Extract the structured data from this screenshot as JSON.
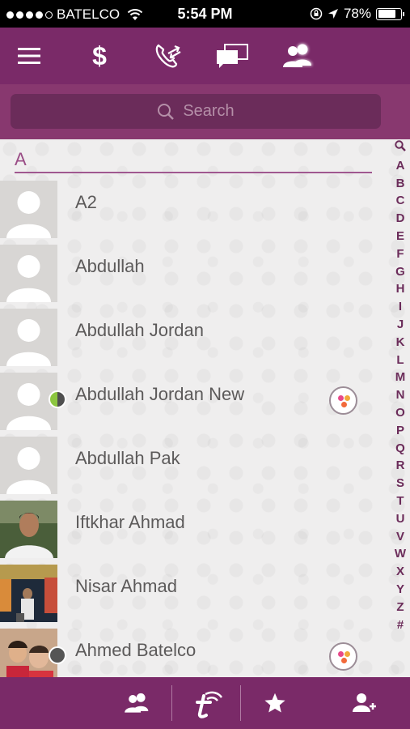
{
  "status_bar": {
    "carrier": "BATELCO",
    "time": "5:54 PM",
    "battery_percent": "78%",
    "battery_level": 0.78,
    "signal_bars": 4,
    "icons": [
      "wifi-icon",
      "orientation-lock-icon",
      "location-icon",
      "battery-icon"
    ]
  },
  "top_nav": {
    "items": [
      "menu-icon",
      "dollar-icon",
      "call-transfer-icon",
      "chat-icon",
      "contacts-icon"
    ],
    "active": "contacts-icon"
  },
  "search": {
    "placeholder": "Search"
  },
  "section": {
    "letter": "A"
  },
  "contacts": [
    {
      "name": "A2",
      "avatar": "default",
      "presence": null,
      "app_badge": false
    },
    {
      "name": "Abdullah",
      "avatar": "default",
      "presence": null,
      "app_badge": false
    },
    {
      "name": "Abdullah Jordan",
      "avatar": "default",
      "presence": null,
      "app_badge": false
    },
    {
      "name": "Abdullah Jordan New",
      "avatar": "default",
      "presence": "half",
      "app_badge": true
    },
    {
      "name": "Abdullah Pak",
      "avatar": "default",
      "presence": null,
      "app_badge": false
    },
    {
      "name": "Iftkhar Ahmad",
      "avatar": "photo",
      "presence": null,
      "app_badge": false
    },
    {
      "name": "Nisar Ahmad",
      "avatar": "photo",
      "presence": null,
      "app_badge": false
    },
    {
      "name": "Ahmed Batelco",
      "avatar": "photo",
      "presence": "offline",
      "app_badge": true
    }
  ],
  "index": [
    "search-icon",
    "A",
    "B",
    "C",
    "D",
    "E",
    "F",
    "G",
    "H",
    "I",
    "J",
    "K",
    "L",
    "M",
    "N",
    "O",
    "P",
    "Q",
    "R",
    "S",
    "T",
    "U",
    "V",
    "W",
    "X",
    "Y",
    "Z",
    "#"
  ],
  "bottom_tabs": [
    "contacts-tab-icon",
    "t-logo-icon",
    "favorites-star-icon",
    "add-contact-icon"
  ],
  "colors": {
    "brand": "#7a2a68",
    "search_band": "#88386f",
    "accent_line": "#a05890",
    "online": "#8cc63f"
  }
}
